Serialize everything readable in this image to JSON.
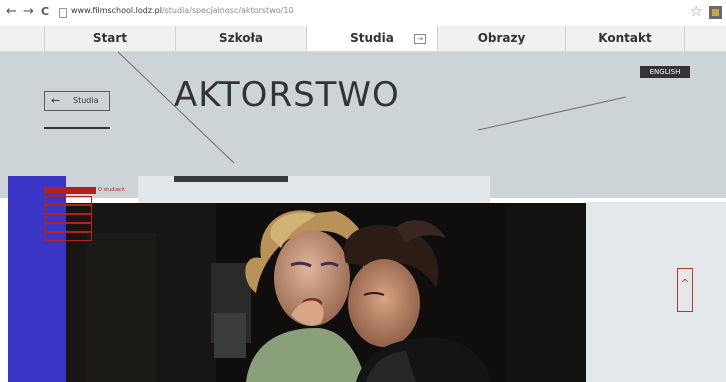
{
  "browser": {
    "back": "←",
    "forward": "→",
    "reload": "C",
    "url_host": "www.filmschool.lodz.pl",
    "url_path": "/studia/specjalnosc/aktorstwo/10",
    "star": "☆"
  },
  "menu": {
    "items": [
      {
        "label": "Start"
      },
      {
        "label": "Szkoła"
      },
      {
        "label": "Studia"
      },
      {
        "label": "Obrazy"
      },
      {
        "label": "Kontakt"
      }
    ],
    "arrow": "→"
  },
  "hero": {
    "title": "AKTORSTWO",
    "back_arrow": "←",
    "back_label": "Studia",
    "language": "ENGLISH"
  },
  "submenu": {
    "label": "O studiach"
  },
  "scroll_top": {
    "glyph": "^"
  },
  "colors": {
    "hero_bg": "#cdd4d8",
    "accent_blue": "#3b35c7",
    "accent_red": "#b3211b"
  }
}
